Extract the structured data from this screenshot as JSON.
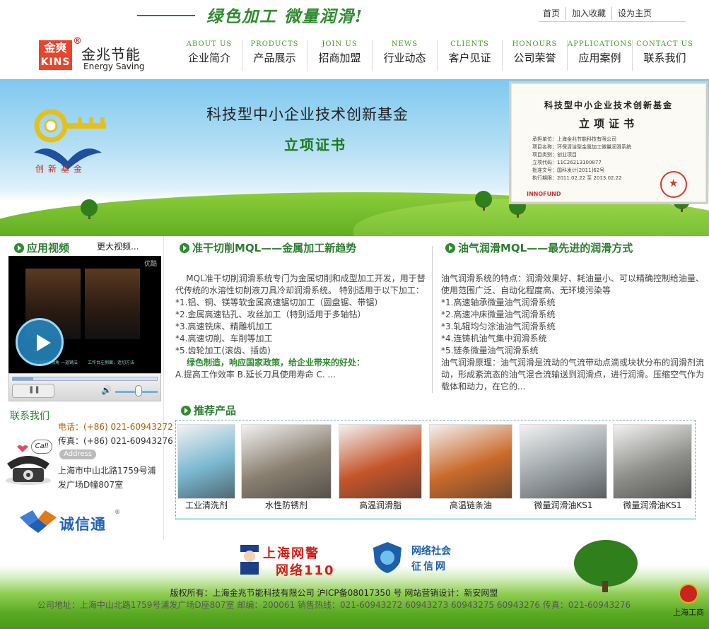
{
  "header": {
    "slogan": "绿色加工 微量润滑!",
    "top_links": [
      "首页",
      "加入收藏",
      "设为主页"
    ],
    "logo": {
      "box_cn": "金爽",
      "box_en": "KINS",
      "reg": "®",
      "name": "金兆节能",
      "sub": "Energy Saving"
    },
    "nav": [
      {
        "en": "ABOUT US",
        "cn": "企业简介"
      },
      {
        "en": "PRODUCTS",
        "cn": "产品展示"
      },
      {
        "en": "JOIN US",
        "cn": "招商加盟"
      },
      {
        "en": "NEWS",
        "cn": "行业动态"
      },
      {
        "en": "CLIENTS",
        "cn": "客户见证"
      },
      {
        "en": "HONOURS",
        "cn": "公司荣誉"
      },
      {
        "en": "APPLICATIONS",
        "cn": "应用案例"
      },
      {
        "en": "CONTACT US",
        "cn": "联系我们"
      }
    ]
  },
  "banner": {
    "title": "科技型中小企业技术创新基金",
    "subtitle": "立项证书",
    "key_label": "创新基金",
    "certificate": {
      "title": "科技型中小企业技术创新基金",
      "subtitle": "立项证书",
      "lines": [
        "承担单位：上海金兆节能科技有限公司",
        "项目名称：环保清洁型金属加工微量润滑系统",
        "项目类别：创业项目",
        "立项代码：11C26213100877",
        "批准文号：国科发计[2011]62号",
        "执行期限：2011.02.22 至 2013.02.22"
      ],
      "logo": "INNOFUND"
    }
  },
  "video": {
    "heading": "应用视频",
    "more": "更大视频...",
    "brand": "优酷",
    "captions": [
      "工作台前后视角 一道铺法",
      "工作台左侧面，连切方法"
    ],
    "progress": 0.14,
    "volume": 0.55
  },
  "contact": {
    "heading": "联系我们",
    "call": "Call",
    "tel": "电话：(+86) 021-60943272",
    "fax": "传真：(+86) 021-60943276",
    "address_button": "Address",
    "address": "上海市中山北路1759号浦发广场D幢807室"
  },
  "cxt": {
    "name": "诚信通",
    "reg": "®"
  },
  "article1": {
    "heading": "准干切削MQL——金属加工新趋势",
    "intro": "    MQL准干切削润滑系统专门为金属切削和成型加工开发，用于替代传统的水溶性切削液刀具冷却润滑系统。 特别适用于以下加工：",
    "items": [
      "*1.铝、铜、镁等软金属高速锯切加工（圆盘锯、带锯）",
      "*2.金属高速钻孔、攻丝加工（特别适用于多轴钻）",
      "*3.高速铣床、精雕机加工",
      "*4.高速切削、车削等加工",
      "*5.齿轮加工(滚齿、插齿)"
    ],
    "highlight": "绿色制造，响应国家政策，给企业带来的好处：",
    "benefits": "A.提高工作效率 B.延长刀具使用寿命 C. ..."
  },
  "article2": {
    "heading": "油气润滑MQL——最先进的润滑方式",
    "intro": "油气润滑系统的特点：润滑效果好、耗油量小、可以精确控制给油量、使用范围广泛、自动化程度高、无环境污染等",
    "items": [
      "*1.高速轴承微量油气润滑系统",
      "*2.高速冲床微量油气润滑系统",
      "*3.轧辊均匀涂油油气润滑系统",
      "*4.连铸机油气集中润滑系统",
      "*5.链条微量油气润滑系统"
    ],
    "principle": "油气润滑原理：油气润滑是流动的气流带动点滴或块状分布的润滑剂流动，形成紊流态的油气混合流输送到润滑点，进行润滑。压缩空气作为载体和动力，在它的..."
  },
  "products": {
    "heading": "推荐产品",
    "items": [
      {
        "name": "工业清洗剂",
        "color": "#7ab8d0"
      },
      {
        "name": "水性防锈剂",
        "color": "#8a7f70"
      },
      {
        "name": "高温润滑脂",
        "color": "#c4552a"
      },
      {
        "name": "高温链条油",
        "color": "#c96a2a"
      },
      {
        "name": "微量润滑油KS1",
        "color": "#9aa2a6"
      },
      {
        "name": "微量润滑油KS1",
        "color": "#8e8e8a"
      }
    ]
  },
  "footer": {
    "badge1_top": "上海网警",
    "badge1_bottom": "网络110",
    "badge2_top": "网络社会",
    "badge2_bottom": "征信网",
    "copyright": "版权所有：上海金兆节能科技有限公司 沪ICP备08017350 号  网站营销设计：新安网盟",
    "address": "公司地址：上海中山北路1759号浦发广场D座807室 邮编：200061 销售热线：021-60943272 60943273 60943275 60943276 传真：021-60943276",
    "gongshang": "上海工商"
  },
  "colors": {
    "accent_green": "#2e7d32",
    "logo_red": "#e8452c",
    "nav_en_green": "#4a9a2a",
    "tel_orange": "#b35a00"
  }
}
